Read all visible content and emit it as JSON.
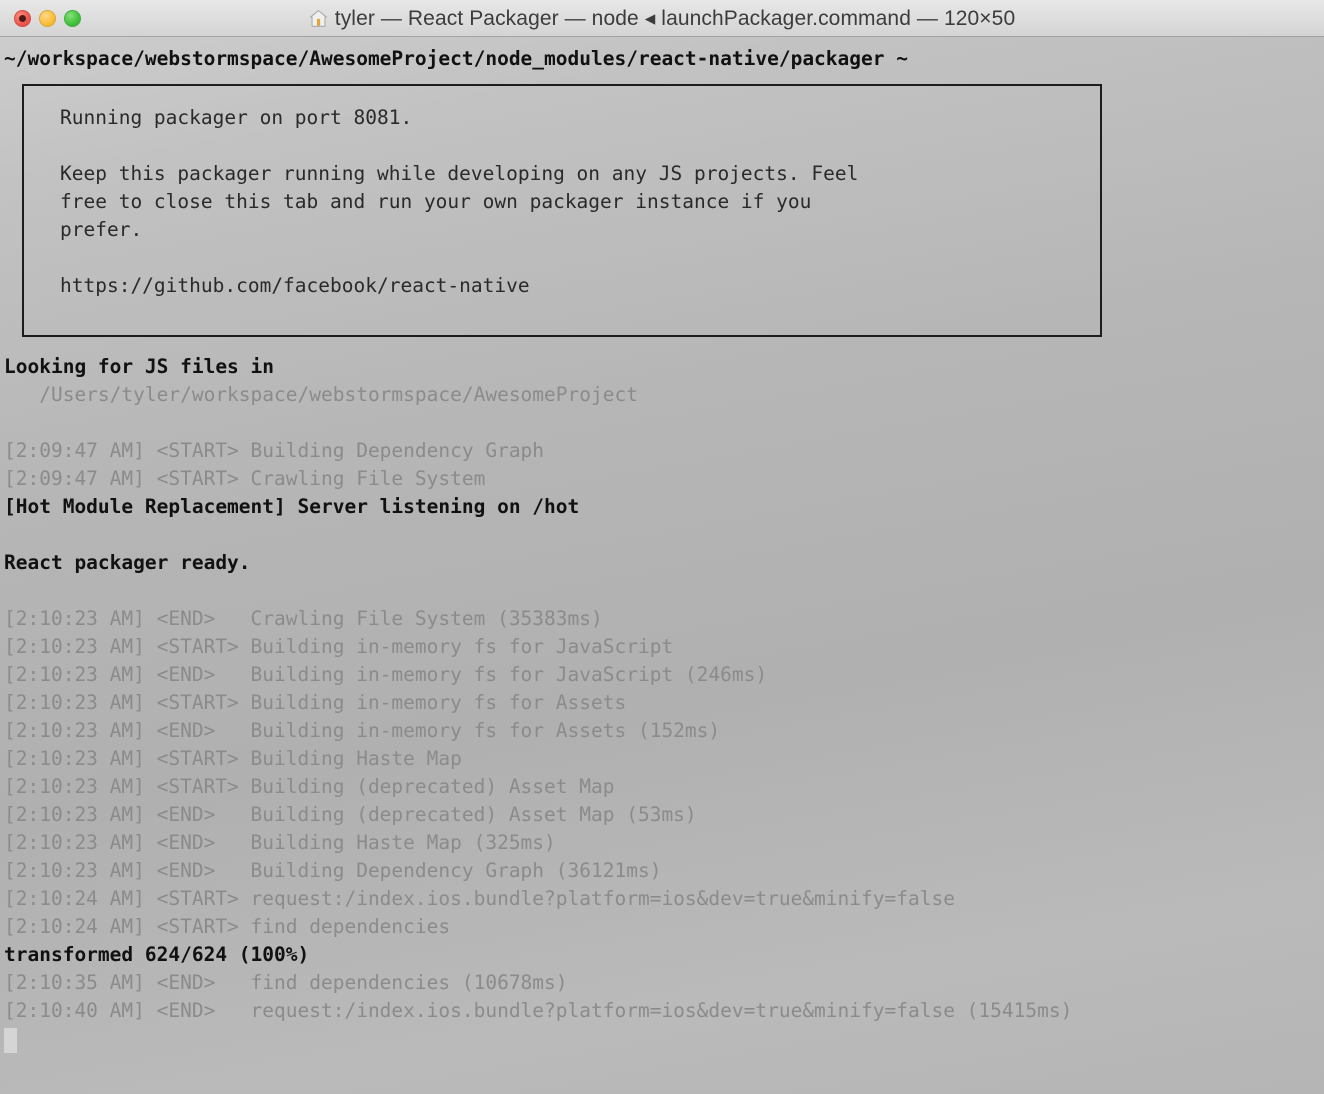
{
  "window": {
    "title": "tyler — React Packager — node ◂ launchPackager.command — 120×50",
    "icon": "home-icon",
    "size_label": "120×50",
    "traffic_lights": [
      {
        "name": "close-button",
        "label": "Close",
        "color": "#f05a52"
      },
      {
        "name": "minimize-button",
        "label": "Minimize",
        "color": "#fbc040"
      },
      {
        "name": "zoom-button",
        "label": "Zoom",
        "color": "#46c33f"
      }
    ]
  },
  "terminal": {
    "prompt_path": "~/workspace/webstormspace/AwesomeProject/node_modules/react-native/packager ~",
    "banner": {
      "line1": "Running packager on port 8081.",
      "line2": "",
      "line3": "Keep this packager running while developing on any JS projects. Feel",
      "line4": "free to close this tab and run your own packager instance if you",
      "line5": "prefer.",
      "line6": "",
      "line7": "https://github.com/facebook/react-native"
    },
    "log": [
      {
        "text": "Looking for JS files in",
        "style": "bold"
      },
      {
        "text": "   /Users/tyler/workspace/webstormspace/AwesomeProject",
        "style": "dim"
      },
      {
        "text": "",
        "style": "blank"
      },
      {
        "text": "[2:09:47 AM] <START> Building Dependency Graph",
        "style": "dim"
      },
      {
        "text": "[2:09:47 AM] <START> Crawling File System",
        "style": "dim"
      },
      {
        "text": "[Hot Module Replacement] Server listening on /hot",
        "style": "bold"
      },
      {
        "text": "",
        "style": "blank"
      },
      {
        "text": "React packager ready.",
        "style": "bold"
      },
      {
        "text": "",
        "style": "blank"
      },
      {
        "text": "[2:10:23 AM] <END>   Crawling File System (35383ms)",
        "style": "dim"
      },
      {
        "text": "[2:10:23 AM] <START> Building in-memory fs for JavaScript",
        "style": "dim"
      },
      {
        "text": "[2:10:23 AM] <END>   Building in-memory fs for JavaScript (246ms)",
        "style": "dim"
      },
      {
        "text": "[2:10:23 AM] <START> Building in-memory fs for Assets",
        "style": "dim"
      },
      {
        "text": "[2:10:23 AM] <END>   Building in-memory fs for Assets (152ms)",
        "style": "dim"
      },
      {
        "text": "[2:10:23 AM] <START> Building Haste Map",
        "style": "dim"
      },
      {
        "text": "[2:10:23 AM] <START> Building (deprecated) Asset Map",
        "style": "dim"
      },
      {
        "text": "[2:10:23 AM] <END>   Building (deprecated) Asset Map (53ms)",
        "style": "dim"
      },
      {
        "text": "[2:10:23 AM] <END>   Building Haste Map (325ms)",
        "style": "dim"
      },
      {
        "text": "[2:10:23 AM] <END>   Building Dependency Graph (36121ms)",
        "style": "dim"
      },
      {
        "text": "[2:10:24 AM] <START> request:/index.ios.bundle?platform=ios&dev=true&minify=false",
        "style": "dim"
      },
      {
        "text": "[2:10:24 AM] <START> find dependencies",
        "style": "dim"
      },
      {
        "text": "transformed 624/624 (100%)",
        "style": "bold"
      },
      {
        "text": "[2:10:35 AM] <END>   find dependencies (10678ms)",
        "style": "dim"
      },
      {
        "text": "[2:10:40 AM] <END>   request:/index.ios.bundle?platform=ios&dev=true&minify=false (15415ms)",
        "style": "dim"
      }
    ],
    "cursor_visible": true
  },
  "colors": {
    "background_top": "#cfcfcf",
    "background_bottom": "#b5b5b5",
    "titlebar": "#dedede",
    "text_bold": "#111111",
    "text_dim": "#8b8b8b",
    "box_border": "#1d1d1d",
    "cursor": "#d5d5d5"
  }
}
